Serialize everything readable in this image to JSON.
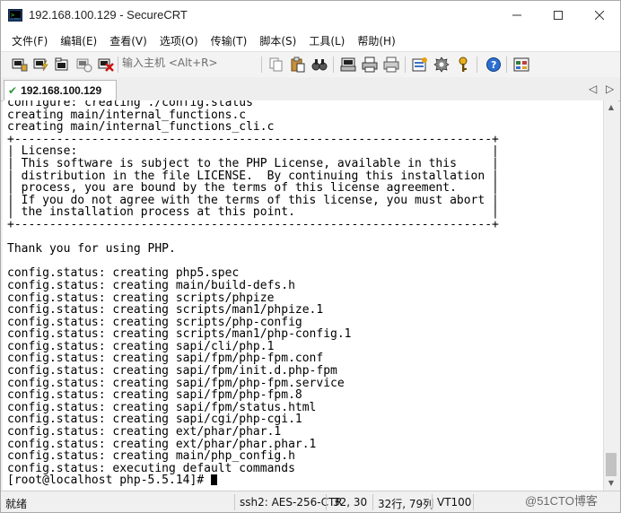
{
  "window": {
    "title": "192.168.100.129 - SecureCRT"
  },
  "menu": [
    "文件(F)",
    "编辑(E)",
    "查看(V)",
    "选项(O)",
    "传输(T)",
    "脚本(S)",
    "工具(L)",
    "帮助(H)"
  ],
  "toolbar": {
    "quick_connect_placeholder": "输入主机 <Alt+R>"
  },
  "tabs": [
    {
      "label": "192.168.100.129",
      "status": "connected"
    }
  ],
  "terminal": {
    "lines": [
      "configure: creating ./config.status",
      "creating main/internal_functions.c",
      "creating main/internal_functions_cli.c",
      "+--------------------------------------------------------------------+",
      "| License:                                                           |",
      "| This software is subject to the PHP License, available in this     |",
      "| distribution in the file LICENSE.  By continuing this installation |",
      "| process, you are bound by the terms of this license agreement.     |",
      "| If you do not agree with the terms of this license, you must abort |",
      "| the installation process at this point.                            |",
      "+--------------------------------------------------------------------+",
      "",
      "Thank you for using PHP.",
      "",
      "config.status: creating php5.spec",
      "config.status: creating main/build-defs.h",
      "config.status: creating scripts/phpize",
      "config.status: creating scripts/man1/phpize.1",
      "config.status: creating scripts/php-config",
      "config.status: creating scripts/man1/php-config.1",
      "config.status: creating sapi/cli/php.1",
      "config.status: creating sapi/fpm/php-fpm.conf",
      "config.status: creating sapi/fpm/init.d.php-fpm",
      "config.status: creating sapi/fpm/php-fpm.service",
      "config.status: creating sapi/fpm/php-fpm.8",
      "config.status: creating sapi/fpm/status.html",
      "config.status: creating sapi/cgi/php-cgi.1",
      "config.status: creating ext/phar/phar.1",
      "config.status: creating ext/phar/phar.phar.1",
      "config.status: creating main/php_config.h",
      "config.status: executing default commands",
      "[root@localhost php-5.5.14]# "
    ]
  },
  "statusbar": {
    "state": "就绪",
    "encryption": "ssh2: AES-256-CTR",
    "cursor_pos": "32,  30",
    "size": "32行, 79列",
    "terminal_type": "VT100"
  },
  "watermark": "@51CTO博客",
  "colors": {
    "checkmark": "#2e9a3a",
    "terminal_bg": "#ffffff",
    "terminal_fg": "#000000"
  }
}
